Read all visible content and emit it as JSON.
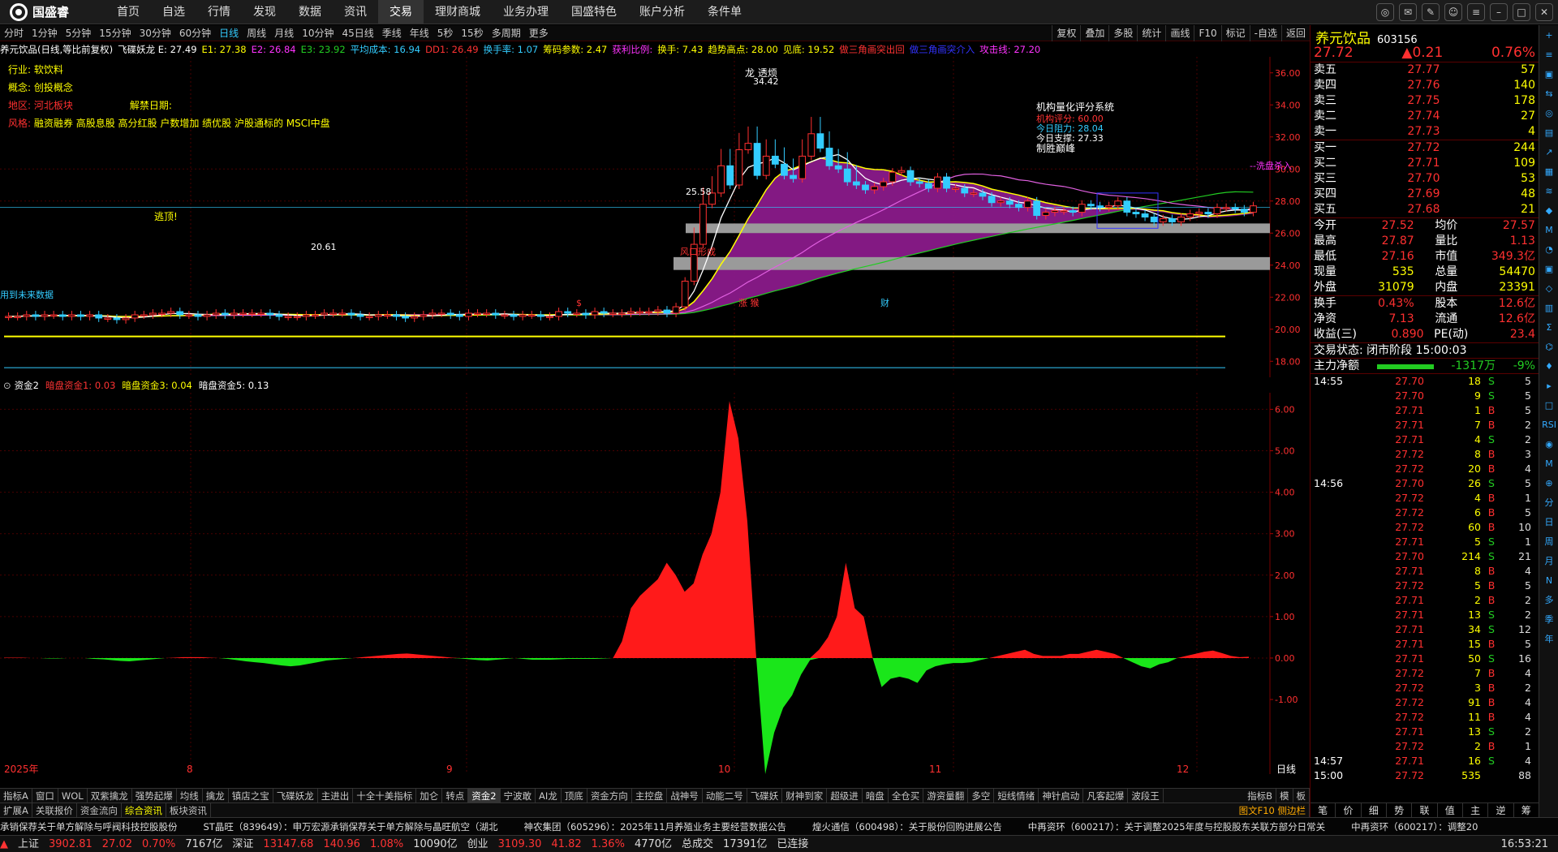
{
  "app": {
    "name": "国盛睿"
  },
  "menu": [
    "首页",
    "自选",
    "行情",
    "发现",
    "数据",
    "资讯",
    "交易",
    "理财商城",
    "业务办理",
    "国盛特色",
    "账户分析",
    "条件单"
  ],
  "periods": [
    "分时",
    "1分钟",
    "5分钟",
    "15分钟",
    "30分钟",
    "60分钟",
    "日线",
    "周线",
    "月线",
    "10分钟",
    "45日线",
    "季线",
    "年线",
    "5秒",
    "15秒",
    "多周期",
    "更多"
  ],
  "tools": [
    "复权",
    "叠加",
    "多股",
    "统计",
    "画线",
    "F10",
    "标记",
    "-自选",
    "返回"
  ],
  "legend": [
    {
      "t": "养元饮品(日线,等比前复权)",
      "c": "#fff"
    },
    {
      "t": "飞碟妖龙 E: 27.49",
      "c": "#fff"
    },
    {
      "t": "E1: 27.38",
      "c": "#ff0"
    },
    {
      "t": "E2: 26.84",
      "c": "#f3f"
    },
    {
      "t": "E3: 23.92",
      "c": "#2c2"
    },
    {
      "t": "平均成本: 16.94",
      "c": "#3cf"
    },
    {
      "t": "DD1: 26.49",
      "c": "#f33"
    },
    {
      "t": "换手率: 1.07",
      "c": "#3cf"
    },
    {
      "t": "筹码参数: 2.47",
      "c": "#ff0"
    },
    {
      "t": "获利比例:",
      "c": "#f3f"
    },
    {
      "t": "换手: 7.43",
      "c": "#ff0"
    },
    {
      "t": "趋势高点: 28.00",
      "c": "#ff0"
    },
    {
      "t": "见底: 19.52",
      "c": "#ff0"
    },
    {
      "t": "做三角画突出回",
      "c": "#f33"
    },
    {
      "t": "做三角画突介入",
      "c": "#33f"
    },
    {
      "t": "攻击线: 27.20",
      "c": "#f3f"
    }
  ],
  "info": {
    "industry": "行业: 软饮料",
    "concept": "概念: 创投概念",
    "region": "地区: 河北板块",
    "unlock": "解禁日期:",
    "style_label": "风格:",
    "style": "融资融券 高股息股 高分红股 户数增加 绩优股 沪股通标的 MSCI中盘"
  },
  "annotations": {
    "top": "龙 透烦",
    "top_price": "34.42",
    "sys": "机构量化评分系统",
    "score": "机构评分: 60.00",
    "resist": "今日阻力: 28.04",
    "support": "今日支撑: 27.33",
    "fight": "制胜巅峰",
    "escape": "逃顶!",
    "low": "20.61",
    "p1": "25.58",
    "flush": "--洗盘杀入",
    "wind": "风口形成",
    "future": "用到未来数据",
    "mark_up": "涨 猴",
    "mark_fin": "财",
    "mark_s": "$"
  },
  "yaxis": [
    "36.00",
    "34.00",
    "32.00",
    "30.00",
    "28.00",
    "26.00",
    "24.00",
    "22.00",
    "20.00",
    "18.00"
  ],
  "sub_legend": [
    {
      "t": "资金2",
      "c": "#fff"
    },
    {
      "t": "暗盘资金1: 0.03",
      "c": "#f33"
    },
    {
      "t": "暗盘资金3: 0.04",
      "c": "#ff0"
    },
    {
      "t": "暗盘资金5: 0.13",
      "c": "#fff"
    }
  ],
  "sub_yaxis": [
    "6.00",
    "5.00",
    "4.00",
    "3.00",
    "2.00",
    "1.00",
    "0.00",
    "-1.00"
  ],
  "xaxis": [
    {
      "t": "2025年"
    },
    {
      "t": "8"
    },
    {
      "t": "9"
    },
    {
      "t": "10"
    },
    {
      "t": "11"
    },
    {
      "t": "12"
    }
  ],
  "xaxis_label": "日线",
  "tabs1": [
    "指标A",
    "窗口",
    "WOL",
    "双紫擒龙",
    "强势起爆",
    "均线",
    "擒龙",
    "镇店之宝",
    "飞碟妖龙",
    "主进出",
    "十全十美指标",
    "加仑",
    "转点",
    "资金2",
    "宁波敢",
    "AI龙",
    "顶底",
    "资金方向",
    "主控盘",
    "战神号",
    "动能二号",
    "飞碟妖",
    "财神到家",
    "超级进",
    "暗盘",
    "全仓买",
    "游资量翻",
    "多空",
    "短线情绪",
    "神针启动",
    "凡客起爆",
    "波段王"
  ],
  "tabs1_on": "资金2",
  "tabs1_right": [
    "指标B",
    "模",
    "板"
  ],
  "tabs2": [
    "扩展A",
    "关联报价",
    "资金流向",
    "综合资讯",
    "板块资讯"
  ],
  "tabs2_on": "综合资讯",
  "tabs2_right": "图文F10 侧边栏",
  "news": [
    "承销保荐关于单方解除与呼阀科技控股股份",
    "ST晶旺（839649）：申万宏源承销保荐关于单方解除与晶旺航空（湖北",
    "神农集团（605296）：2025年11月养殖业务主要经营数据公告",
    "煌火通信（600498）：关于股份回购进展公告",
    "中再资环（600217）：关于调整2025年度与控股股东关联方部分日常关",
    "中再资环（600217）：调整20"
  ],
  "status": [
    {
      "t": "上证",
      "c": "#ddd"
    },
    {
      "t": "3902.81",
      "c": "#f33"
    },
    {
      "t": "27.02",
      "c": "#f33"
    },
    {
      "t": "0.70%",
      "c": "#f33"
    },
    {
      "t": "7167亿",
      "c": "#ddd"
    },
    {
      "t": "深证",
      "c": "#ddd"
    },
    {
      "t": "13147.68",
      "c": "#f33"
    },
    {
      "t": "140.96",
      "c": "#f33"
    },
    {
      "t": "1.08%",
      "c": "#f33"
    },
    {
      "t": "10090亿",
      "c": "#ddd"
    },
    {
      "t": "创业",
      "c": "#ddd"
    },
    {
      "t": "3109.30",
      "c": "#f33"
    },
    {
      "t": "41.82",
      "c": "#f33"
    },
    {
      "t": "1.36%",
      "c": "#f33"
    },
    {
      "t": "4770亿",
      "c": "#ddd"
    },
    {
      "t": "总成交",
      "c": "#ddd"
    },
    {
      "t": "17391亿",
      "c": "#ddd"
    },
    {
      "t": "已连接",
      "c": "#ddd"
    }
  ],
  "clock": "16:53:21",
  "quote": {
    "name": "养元饮品",
    "code": "603156",
    "price": "27.72",
    "change": "0.21",
    "pct": "0.76%",
    "asks": [
      [
        "卖五",
        "27.77",
        "57"
      ],
      [
        "卖四",
        "27.76",
        "140"
      ],
      [
        "卖三",
        "27.75",
        "178"
      ],
      [
        "卖二",
        "27.74",
        "27"
      ],
      [
        "卖一",
        "27.73",
        "4"
      ]
    ],
    "bids": [
      [
        "买一",
        "27.72",
        "244"
      ],
      [
        "买二",
        "27.71",
        "109"
      ],
      [
        "买三",
        "27.70",
        "53"
      ],
      [
        "买四",
        "27.69",
        "48"
      ],
      [
        "买五",
        "27.68",
        "21"
      ]
    ],
    "stats": [
      [
        "今开",
        "27.52",
        "均价",
        "27.57"
      ],
      [
        "最高",
        "27.87",
        "量比",
        "1.13"
      ],
      [
        "最低",
        "27.16",
        "市值",
        "349.3亿"
      ],
      [
        "现量",
        "535",
        "总量",
        "54470"
      ],
      [
        "外盘",
        "31079",
        "内盘",
        "23391"
      ]
    ],
    "stats2": [
      [
        "换手",
        "0.43%",
        "股本",
        "12.6亿"
      ],
      [
        "净资",
        "7.13",
        "流通",
        "12.6亿"
      ],
      [
        "收益(三)",
        "0.890",
        "PE(动)",
        "23.4"
      ]
    ],
    "state": "交易状态: 闭市阶段 15:00:03",
    "main_net_label": "主力净额",
    "main_net": "-1317万",
    "main_pct": "-9%"
  },
  "ticks": [
    [
      "14:55",
      "27.70",
      "18",
      "S",
      "5"
    ],
    [
      "",
      "27.70",
      "9",
      "S",
      "5"
    ],
    [
      "",
      "27.71",
      "1",
      "B",
      "5"
    ],
    [
      "",
      "27.71",
      "7",
      "B",
      "2"
    ],
    [
      "",
      "27.71",
      "4",
      "S",
      "2"
    ],
    [
      "",
      "27.72",
      "8",
      "B",
      "3"
    ],
    [
      "",
      "27.72",
      "20",
      "B",
      "4"
    ],
    [
      "14:56",
      "27.70",
      "26",
      "S",
      "5"
    ],
    [
      "",
      "27.72",
      "4",
      "B",
      "1"
    ],
    [
      "",
      "27.72",
      "6",
      "B",
      "5"
    ],
    [
      "",
      "27.72",
      "60",
      "B",
      "10"
    ],
    [
      "",
      "27.71",
      "5",
      "S",
      "1"
    ],
    [
      "",
      "27.70",
      "214",
      "S",
      "21"
    ],
    [
      "",
      "27.71",
      "8",
      "B",
      "4"
    ],
    [
      "",
      "27.72",
      "5",
      "B",
      "5"
    ],
    [
      "",
      "27.71",
      "2",
      "B",
      "2"
    ],
    [
      "",
      "27.71",
      "13",
      "S",
      "2"
    ],
    [
      "",
      "27.71",
      "34",
      "S",
      "12"
    ],
    [
      "",
      "27.71",
      "15",
      "B",
      "5"
    ],
    [
      "",
      "27.71",
      "50",
      "S",
      "16"
    ],
    [
      "",
      "27.72",
      "7",
      "B",
      "4"
    ],
    [
      "",
      "27.72",
      "3",
      "B",
      "2"
    ],
    [
      "",
      "27.72",
      "91",
      "B",
      "4"
    ],
    [
      "",
      "27.72",
      "11",
      "B",
      "4"
    ],
    [
      "",
      "27.71",
      "13",
      "S",
      "2"
    ],
    [
      "",
      "27.72",
      "2",
      "B",
      "1"
    ],
    [
      "14:57",
      "27.71",
      "16",
      "S",
      "4"
    ],
    [
      "15:00",
      "27.72",
      "535",
      "",
      "88"
    ]
  ],
  "rtabs": [
    "笔",
    "价",
    "细",
    "势",
    "联",
    "值",
    "主",
    "逆",
    "筹"
  ],
  "rside": [
    "+",
    "≡",
    "▣",
    "⇆",
    "◎",
    "▤",
    "↗",
    "▦",
    "≋",
    "◆",
    "M",
    "◔",
    "▣",
    "◇",
    "▥",
    "Σ",
    "⌬",
    "♦",
    "▸",
    "□",
    "RSI",
    "◉",
    "M",
    "⊕",
    "分",
    "日",
    "周",
    "月",
    "N",
    "多",
    "季",
    "年"
  ],
  "chart_data": [
    {
      "type": "candlestick",
      "title": "养元饮品(日线,等比前复权)",
      "ylim": [
        17,
        37
      ],
      "x_categories": [
        "2025年",
        "8",
        "9",
        "10",
        "11",
        "12"
      ],
      "close": [
        20.8,
        20.8,
        20.9,
        20.8,
        20.9,
        20.9,
        20.8,
        20.9,
        20.8,
        20.9,
        20.7,
        20.7,
        20.6,
        20.7,
        20.9,
        20.9,
        21.0,
        21.0,
        21.1,
        20.9,
        20.9,
        20.8,
        20.9,
        21.0,
        20.9,
        21.0,
        21.0,
        21.0,
        21.0,
        20.9,
        20.8,
        20.8,
        20.8,
        20.9,
        20.9,
        21.0,
        21.0,
        21.0,
        20.9,
        20.8,
        20.8,
        20.9,
        20.9,
        20.8,
        20.7,
        20.8,
        20.9,
        21.0,
        21.0,
        20.9,
        20.8,
        21.0,
        21.0,
        21.0,
        20.9,
        20.9,
        20.8,
        20.9,
        20.9,
        20.8,
        20.8,
        21.1,
        21.0,
        21.0,
        20.9,
        21.1,
        21.0,
        21.0,
        21.0,
        21.1,
        21.1,
        21.1,
        21.2,
        21.0,
        21.4,
        23.0,
        25.3,
        27.8,
        28.5,
        30.2,
        29.0,
        31.2,
        31.6,
        29.6,
        30.8,
        30.3,
        29.6,
        29.4,
        30.8,
        32.2,
        31.3,
        30.2,
        30.0,
        29.2,
        29.0,
        28.7,
        28.9,
        29.2,
        29.8,
        29.9,
        29.2,
        29.1,
        28.8,
        29.5,
        28.8,
        28.8,
        28.5,
        28.5,
        28.3,
        27.9,
        28.0,
        27.8,
        27.6,
        28.0,
        27.1,
        27.3,
        27.4,
        27.4,
        27.3,
        27.8,
        27.7,
        27.6,
        27.7,
        28.0,
        27.3,
        27.2,
        27.0,
        26.7,
        26.9,
        26.7,
        27.0,
        27.2,
        27.3,
        27.2,
        27.6,
        27.6,
        27.5,
        27.3,
        27.7
      ]
    },
    {
      "type": "area",
      "title": "资金2",
      "ylim": [
        -2.8,
        6.4
      ],
      "ylabel": "",
      "series": [
        {
          "name": "暗盘资金1",
          "values": [
            0.01,
            0.01,
            0.01,
            0,
            0,
            -0.01,
            -0.01,
            0,
            0,
            0,
            -0.02,
            -0.03,
            -0.05,
            -0.07,
            -0.08,
            -0.06,
            -0.04,
            -0.02,
            0,
            0.01,
            0.02,
            0.02,
            0.02,
            0.01,
            0,
            -0.02,
            -0.05,
            -0.08,
            -0.1,
            -0.12,
            -0.15,
            -0.18,
            -0.2,
            -0.18,
            -0.14,
            -0.1,
            -0.06,
            -0.04,
            -0.02,
            0,
            0.02,
            0.04,
            0.06,
            0.08,
            0.1,
            0.11,
            0.09,
            0.07,
            0.05,
            0.03,
            0.01,
            -0.01,
            -0.03,
            -0.05,
            -0.06,
            -0.04,
            -0.02,
            0,
            -0.02,
            -0.04,
            -0.04,
            -0.04,
            -0.03,
            -0.02,
            -0.02,
            -0.02,
            -0.02,
            -0.01,
            0,
            0.4,
            1.2,
            1.5,
            1.7,
            1.9,
            2.3,
            2.0,
            1.6,
            1.8,
            2.5,
            3.0,
            4.0,
            6.2,
            5.3,
            3.3,
            0,
            -2.8,
            -1.8,
            -1.2,
            -0.9,
            -0.4,
            -0.05,
            0.2,
            0.5,
            1.0,
            2.3,
            1.2,
            1.0,
            0,
            -0.7,
            -0.5,
            -0.45,
            -0.5,
            -0.6,
            -0.3,
            -0.2,
            -0.15,
            -0.12,
            -0.12,
            -0.1,
            -0.05,
            0,
            0.05,
            0.1,
            0.15,
            0.2,
            0.1,
            0.05,
            0.05,
            0.05,
            0.1,
            0.1,
            0.15,
            0.2,
            0.15,
            0.1,
            0,
            -0.1,
            -0.2,
            -0.25,
            -0.15,
            -0.1,
            0,
            0.05,
            0.1,
            0.15,
            0.18,
            0.12,
            0.05,
            0.02,
            0.03
          ]
        }
      ]
    }
  ]
}
